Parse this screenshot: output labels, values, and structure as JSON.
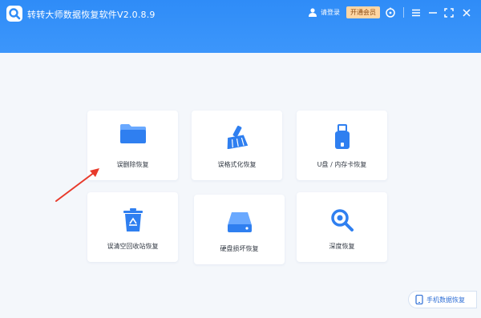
{
  "app": {
    "title": "转转大师数据恢复软件V2.0.8.9"
  },
  "header": {
    "login_label": "请登录",
    "vip_label": "开通会员"
  },
  "cards": [
    {
      "label": "误删除恢复",
      "icon": "folder-icon"
    },
    {
      "label": "误格式化恢复",
      "icon": "broom-icon"
    },
    {
      "label": "U盘 / 内存卡恢复",
      "icon": "usb-drive-icon"
    },
    {
      "label": "误清空回收站恢复",
      "icon": "recycle-bin-icon"
    },
    {
      "label": "硬盘损坏恢复",
      "icon": "hard-drive-icon"
    },
    {
      "label": "深度恢复",
      "icon": "deep-scan-icon"
    }
  ],
  "mobile_recovery_label": "手机数据恢复",
  "colors": {
    "header_blue": "#3a93fa",
    "accent_blue": "#2f7ff0",
    "vip_bg": "#ffd6a3",
    "arrow_red": "#e83a2b"
  }
}
